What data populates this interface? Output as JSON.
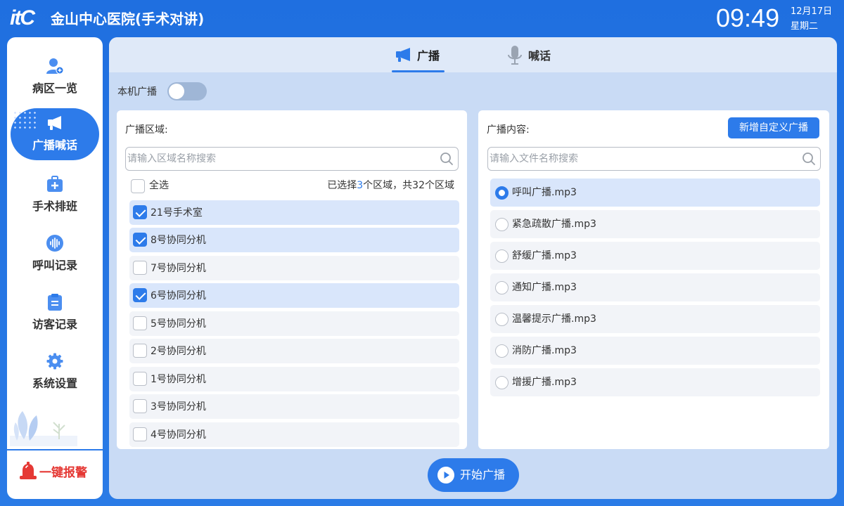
{
  "header": {
    "logo": "itC",
    "title": "金山中心医院(手术对讲)",
    "time": "09:49",
    "date": "12月17日",
    "weekday": "星期二"
  },
  "sidebar": {
    "items": [
      {
        "label": "病区一览",
        "icon": "ward-user-icon"
      },
      {
        "label": "广播喊话",
        "icon": "megaphone-icon",
        "active": true
      },
      {
        "label": "手术排班",
        "icon": "medical-kit-icon"
      },
      {
        "label": "呼叫记录",
        "icon": "voice-wave-icon"
      },
      {
        "label": "访客记录",
        "icon": "clipboard-icon"
      },
      {
        "label": "系统设置",
        "icon": "gear-icon"
      }
    ],
    "alarm_label": "一键报警"
  },
  "tabs": [
    {
      "label": "广播",
      "icon": "megaphone-icon",
      "active": true
    },
    {
      "label": "喊话",
      "icon": "microphone-icon",
      "active": false
    }
  ],
  "local_broadcast": {
    "label": "本机广播",
    "enabled": false
  },
  "zones": {
    "title": "广播区域:",
    "search_placeholder": "请输入区域名称搜索",
    "select_all_label": "全选",
    "summary_prefix": "已选择",
    "selected_count": "3",
    "summary_suffix": "个区域，共32个区域",
    "items": [
      {
        "name": "21号手术室",
        "checked": true
      },
      {
        "name": "8号协同分机",
        "checked": true
      },
      {
        "name": "7号协同分机",
        "checked": false
      },
      {
        "name": "6号协同分机",
        "checked": true
      },
      {
        "name": "5号协同分机",
        "checked": false
      },
      {
        "name": "2号协同分机",
        "checked": false
      },
      {
        "name": "1号协同分机",
        "checked": false
      },
      {
        "name": "3号协同分机",
        "checked": false
      },
      {
        "name": "4号协同分机",
        "checked": false
      }
    ]
  },
  "content": {
    "title": "广播内容:",
    "add_button": "新增自定义广播",
    "search_placeholder": "请输入文件名称搜索",
    "files": [
      {
        "name": "呼叫广播.mp3",
        "selected": true
      },
      {
        "name": "紧急疏散广播.mp3",
        "selected": false
      },
      {
        "name": "舒缓广播.mp3",
        "selected": false
      },
      {
        "name": "通知广播.mp3",
        "selected": false
      },
      {
        "name": "温馨提示广播.mp3",
        "selected": false
      },
      {
        "name": "消防广播.mp3",
        "selected": false
      },
      {
        "name": "增援广播.mp3",
        "selected": false
      }
    ]
  },
  "start_button": "开始广播",
  "colors": {
    "primary": "#2d7bea",
    "alarm": "#e53935",
    "panel": "#c9dbf5"
  }
}
